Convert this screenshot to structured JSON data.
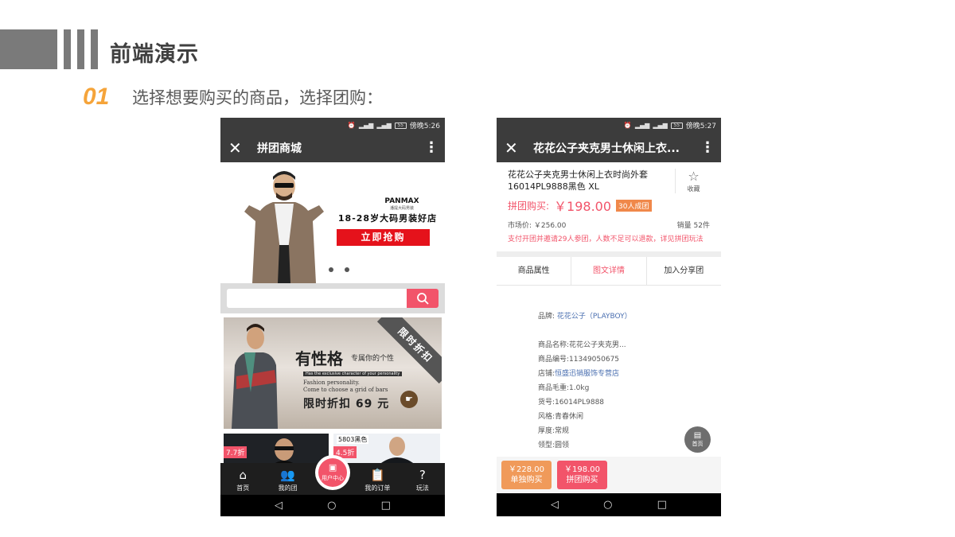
{
  "slide": {
    "title": "前端演示",
    "step_number": "01",
    "step_text": "选择想要购买的商品，选择团购："
  },
  "left_phone": {
    "status_time": "傍晚5:26",
    "status_battery": "55",
    "app_title": "拼团商城",
    "banner": {
      "brand": "PANMAX",
      "brand_sub": "潘提大码男装",
      "slogan": "18-28岁大码男装好店",
      "cta": "立即抢购"
    },
    "search": {
      "placeholder": ""
    },
    "promo": {
      "tag": "限时折扣",
      "big": "有性格",
      "small": "专属你的个性",
      "en1": "Has the exclusive character of your personality",
      "en2": "Fashion personality.",
      "en3": "Come to choose a grid of bars",
      "sale": "限时折扣 69 元"
    },
    "products": [
      {
        "discount": "7.7折"
      },
      {
        "discount": "4.5折",
        "code": "5803黑色"
      }
    ],
    "tabs": [
      {
        "label": "首页",
        "icon": "home-icon"
      },
      {
        "label": "我的团",
        "icon": "group-icon"
      },
      {
        "label": "用户中心",
        "icon": "user-card-icon"
      },
      {
        "label": "我的订单",
        "icon": "order-icon"
      },
      {
        "label": "玩法",
        "icon": "help-icon"
      }
    ]
  },
  "right_phone": {
    "status_time": "傍晚5:27",
    "status_battery": "55",
    "app_title": "花花公子夹克男士休闲上衣...",
    "product_title": "花花公子夹克男士休闲上衣时尚外套16014PL9888黑色 XL",
    "favorite_label": "收藏",
    "group_label": "拼团购买:",
    "group_price": "￥198.00",
    "group_badge": "30人成团",
    "market_price": "市场价: ￥256.00",
    "sales": "销量 52件",
    "notice": "支付开团并邀请29人参团，人数不足可以退款，详见拼团玩法",
    "tabs": [
      "商品属性",
      "图文详情",
      "加入分享团"
    ],
    "active_tab": 1,
    "attributes": {
      "brand_label": "品牌:",
      "brand_value": "花花公子（PLAYBOY）",
      "rows": [
        {
          "label": "商品名称:",
          "value": "花花公子夹克男..."
        },
        {
          "label": "商品编号:",
          "value": "11349050675"
        },
        {
          "label": "店铺:",
          "value": "恒盛迅销服饰专营店"
        },
        {
          "label": "商品毛重:",
          "value": "1.0kg"
        },
        {
          "label": "货号:",
          "value": "16014PL9888"
        },
        {
          "label": "风格:",
          "value": "青春休闲"
        },
        {
          "label": "厚度:",
          "value": "常规"
        },
        {
          "label": "领型:",
          "value": "圆领"
        }
      ]
    },
    "float_home_label": "首页",
    "buy_single": {
      "price": "￥228.00",
      "label": "单独购买"
    },
    "buy_group": {
      "price": "￥198.00",
      "label": "拼团购买"
    }
  },
  "colors": {
    "accent": "#f2546a",
    "orange": "#f5a43a",
    "dark_bar": "#3c3c3c"
  }
}
